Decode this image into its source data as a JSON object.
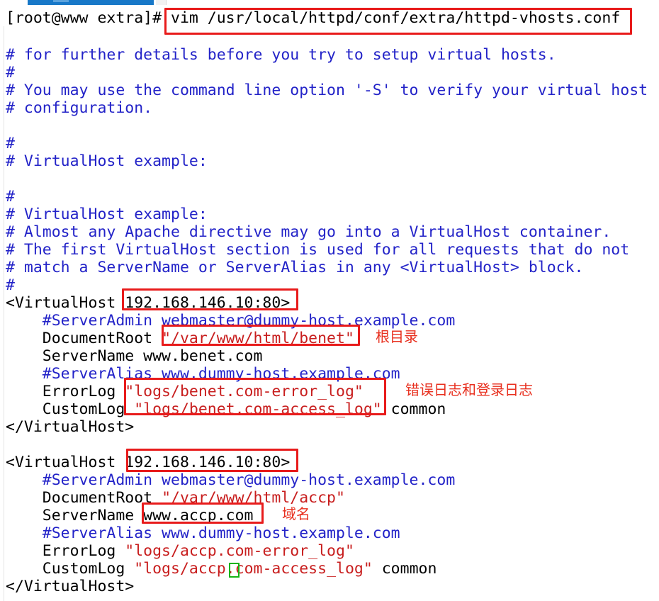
{
  "window": {
    "app": "vim",
    "tab_bar": {
      "active_tab_color": "#1878c8"
    }
  },
  "prompt": {
    "user_host_dir": "[root@www extra]# ",
    "command": "vim /usr/local/httpd/conf/extra/httpd-vhosts.conf"
  },
  "colors": {
    "comment": "#2323c8",
    "string": "#c81e1e",
    "normal": "#000000",
    "annotation": "#e8301f",
    "annotation_box": "#e81b1b",
    "cursor": "#16b316",
    "tab_active": "#1878c8"
  },
  "editor": {
    "filename": "/usr/local/httpd/conf/extra/httpd-vhosts.conf",
    "cursor": {
      "char": ".",
      "line_index": 35,
      "column": 22
    },
    "lines": [
      {
        "text": "# for further details before you try to setup virtual hosts.",
        "kind": "comment"
      },
      {
        "text": "#",
        "kind": "comment"
      },
      {
        "text": "# You may use the command line option '-S' to verify your virtual host",
        "kind": "comment"
      },
      {
        "text": "# configuration.",
        "kind": "comment"
      },
      {
        "text": "",
        "kind": "blank"
      },
      {
        "text": "#",
        "kind": "comment"
      },
      {
        "text": "# VirtualHost example:",
        "kind": "comment"
      },
      {
        "text": "",
        "kind": "blank"
      },
      {
        "text": "#",
        "kind": "comment"
      },
      {
        "text": "# VirtualHost example:",
        "kind": "comment"
      },
      {
        "text": "# Almost any Apache directive may go into a VirtualHost container.",
        "kind": "comment"
      },
      {
        "text": "# The first VirtualHost section is used for all requests that do not",
        "kind": "comment"
      },
      {
        "text": "# match a ServerName or ServerAlias in any <VirtualHost> block.",
        "kind": "comment"
      },
      {
        "text": "#",
        "kind": "comment"
      },
      {
        "text": "<VirtualHost 192.168.146.10:80>",
        "kind": "code"
      },
      {
        "text": "    #ServerAdmin webmaster@dummy-host.example.com",
        "kind": "comment"
      },
      {
        "text": "    DocumentRoot \"/var/www/html/benet\"",
        "kind": "code-string"
      },
      {
        "text": "    ServerName www.benet.com",
        "kind": "code"
      },
      {
        "text": "    #ServerAlias www.dummy-host.example.com",
        "kind": "comment"
      },
      {
        "text": "    ErrorLog \"logs/benet.com-error_log\"",
        "kind": "code-string"
      },
      {
        "text": "    CustomLog \"logs/benet.com-access_log\" common",
        "kind": "code-string"
      },
      {
        "text": "</VirtualHost>",
        "kind": "code"
      },
      {
        "text": "",
        "kind": "blank"
      },
      {
        "text": "<VirtualHost 192.168.146.10:80>",
        "kind": "code"
      },
      {
        "text": "    #ServerAdmin webmaster@dummy-host.example.com",
        "kind": "comment"
      },
      {
        "text": "    DocumentRoot \"/var/www/html/accp\"",
        "kind": "code-string"
      },
      {
        "text": "    ServerName www.accp.com",
        "kind": "code"
      },
      {
        "text": "    #ServerAlias www.dummy-host.example.com",
        "kind": "comment"
      },
      {
        "text": "    ErrorLog \"logs/accp.com-error_log\"",
        "kind": "code-string"
      },
      {
        "text": "    CustomLog \"logs/accp.com-access_log\" common",
        "kind": "code-string"
      },
      {
        "text": "</VirtualHost>",
        "kind": "code"
      }
    ]
  },
  "annotations": {
    "root_directory": "根目录",
    "logs": "错误日志和登录日志",
    "domain_name": "域名"
  },
  "segments": {
    "l14_a": "<VirtualHost 192.168.146.10:80>",
    "l16_pre": "    DocumentRoot ",
    "l16_str": "\"/var/www/html/benet\"",
    "l19_pre": "    ErrorLog ",
    "l19_str": "\"logs/benet.com-error_log\"",
    "l20_pre": "    CustomLog ",
    "l20_str": "\"logs/benet.com-access_log\"",
    "l20_post": " common",
    "l25_pre": "    DocumentRoot ",
    "l25_str": "\"/var/www/html/accp\"",
    "l28_pre": "    ErrorLog ",
    "l28_str": "\"logs/accp.com-error_log\"",
    "l29_pre": "    CustomLog ",
    "l29_str_a": "\"logs/accp",
    "l29_cursor": ".",
    "l29_str_b": "com-access_log\"",
    "l29_post": " common"
  }
}
